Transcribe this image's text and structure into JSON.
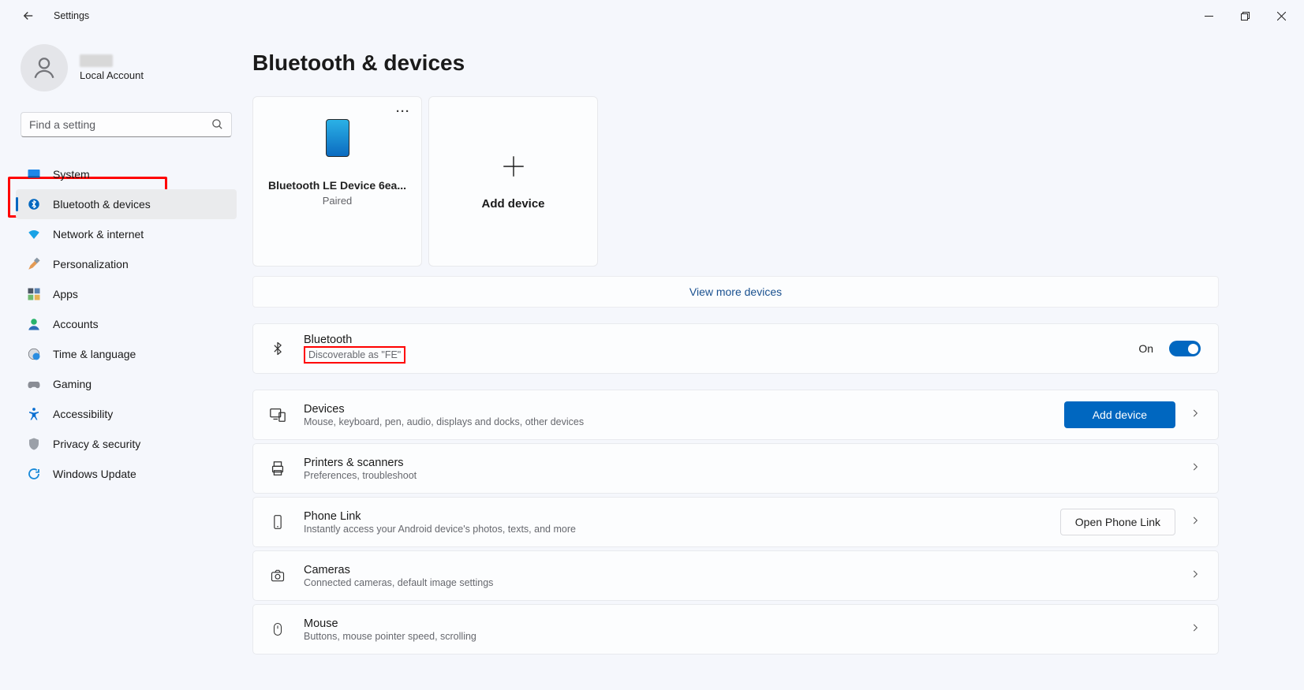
{
  "window": {
    "title": "Settings"
  },
  "profile": {
    "account_type": "Local Account"
  },
  "search": {
    "placeholder": "Find a setting"
  },
  "sidebar": {
    "items": [
      {
        "label": "System"
      },
      {
        "label": "Bluetooth & devices"
      },
      {
        "label": "Network & internet"
      },
      {
        "label": "Personalization"
      },
      {
        "label": "Apps"
      },
      {
        "label": "Accounts"
      },
      {
        "label": "Time & language"
      },
      {
        "label": "Gaming"
      },
      {
        "label": "Accessibility"
      },
      {
        "label": "Privacy & security"
      },
      {
        "label": "Windows Update"
      }
    ]
  },
  "page": {
    "title": "Bluetooth & devices"
  },
  "device_card": {
    "name": "Bluetooth LE Device 6ea...",
    "state": "Paired"
  },
  "add_card": {
    "label": "Add device"
  },
  "more_devices": "View more devices",
  "bluetooth_item": {
    "title": "Bluetooth",
    "sub": "Discoverable as \"FE\"",
    "state_text": "On"
  },
  "devices_item": {
    "title": "Devices",
    "sub": "Mouse, keyboard, pen, audio, displays and docks, other devices",
    "action": "Add device"
  },
  "printers_item": {
    "title": "Printers & scanners",
    "sub": "Preferences, troubleshoot"
  },
  "phone_item": {
    "title": "Phone Link",
    "sub": "Instantly access your Android device's photos, texts, and more",
    "action": "Open Phone Link"
  },
  "cameras_item": {
    "title": "Cameras",
    "sub": "Connected cameras, default image settings"
  },
  "mouse_item": {
    "title": "Mouse",
    "sub": "Buttons, mouse pointer speed, scrolling"
  }
}
